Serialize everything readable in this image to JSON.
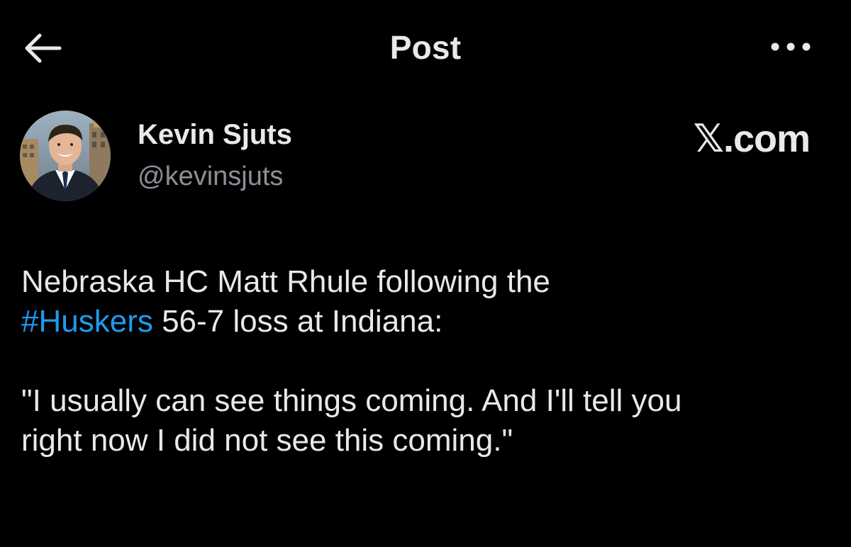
{
  "header": {
    "title": "Post",
    "back_icon": "arrow-left-icon",
    "more_icon": "more-dots-icon"
  },
  "post": {
    "author": {
      "name": "Kevin Sjuts",
      "handle": "@kevinsjuts",
      "avatar": "avatar-photo"
    },
    "brand": "𝕏.com",
    "body": {
      "line1": "Nebraska HC Matt Rhule following the",
      "hashtag": "#Huskers",
      "line2_rest": " 56-7 loss at Indiana:",
      "quote_line1": "\"I usually can see things coming.  And I'll tell you",
      "quote_line2": "right now I did not see this coming.\""
    }
  },
  "colors": {
    "background": "#000000",
    "text": "#e7e9ea",
    "secondary": "#8b9097",
    "accent": "#1d9bf0"
  }
}
